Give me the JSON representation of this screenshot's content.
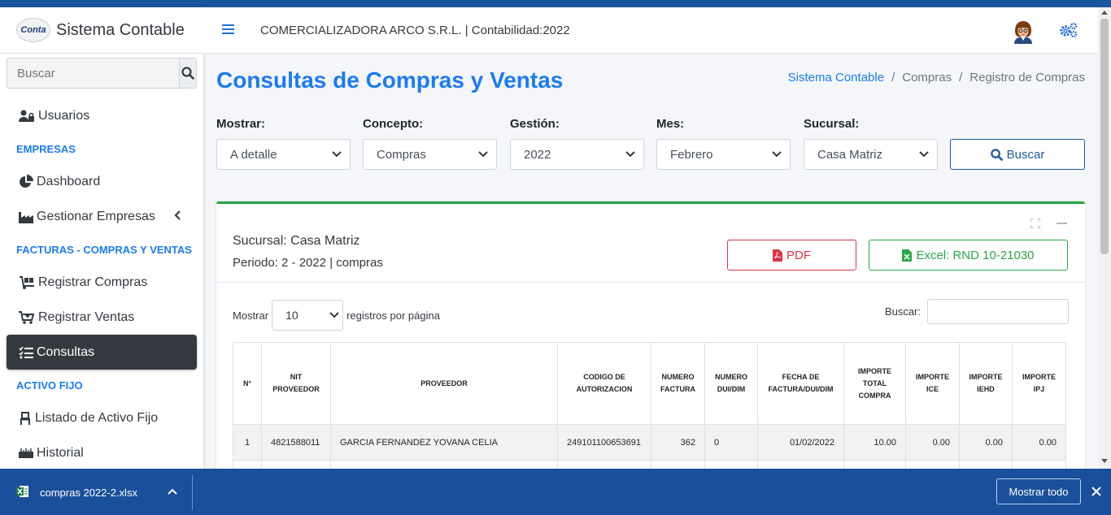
{
  "app": {
    "title": "Sistema Contable",
    "logo_text": "Conta"
  },
  "topbar": {
    "company": "COMERCIALIZADORA ARCO S.R.L. | Contabilidad:2022"
  },
  "sidebar": {
    "search_placeholder": "Buscar",
    "items": [
      {
        "type": "item",
        "label": "Usuarios",
        "icon": "users-lock-icon"
      },
      {
        "type": "header",
        "label": "EMPRESAS"
      },
      {
        "type": "item",
        "label": "Dashboard",
        "icon": "pie-chart-icon"
      },
      {
        "type": "item",
        "label": "Gestionar Empresas",
        "icon": "industry-icon"
      },
      {
        "type": "header",
        "label": "FACTURAS - COMPRAS Y VENTAS"
      },
      {
        "type": "item",
        "label": "Registrar Compras",
        "icon": "dolly-icon"
      },
      {
        "type": "item",
        "label": "Registrar Ventas",
        "icon": "cart-plus-icon"
      },
      {
        "type": "item",
        "label": "Consultas",
        "icon": "list-check-icon",
        "active": true
      },
      {
        "type": "header",
        "label": "ACTIVO FIJO"
      },
      {
        "type": "item",
        "label": "Listado de Activo Fijo",
        "icon": "chair-icon"
      },
      {
        "type": "item",
        "label": "Historial",
        "icon": "ruler-icon"
      }
    ]
  },
  "page": {
    "title": "Consultas de Compras y Ventas",
    "breadcrumb": [
      "Sistema Contable",
      "Compras",
      "Registro de Compras"
    ]
  },
  "filters": {
    "mostrar_label": "Mostrar:",
    "mostrar_value": "A detalle",
    "concepto_label": "Concepto:",
    "concepto_value": "Compras",
    "gestion_label": "Gestión:",
    "gestion_value": "2022",
    "mes_label": "Mes:",
    "mes_value": "Febrero",
    "sucursal_label": "Sucursal:",
    "sucursal_value": "Casa Matriz",
    "buscar_label": "Buscar"
  },
  "report": {
    "sucursal": "Sucursal: Casa Matriz",
    "periodo": "Periodo: 2 - 2022 | compras",
    "pdf_label": "PDF",
    "excel_label": "Excel: RND 10-21030",
    "length_prefix": "Mostrar",
    "length_value": "10",
    "length_suffix": "registros por página",
    "search_label": "Buscar:"
  },
  "table": {
    "headers": [
      "N°",
      "NIT PROVEEDOR",
      "PROVEEDOR",
      "CODIGO DE AUTORIZACION",
      "NUMERO FACTURA",
      "NUMERO DUI/DIM",
      "FECHA DE FACTURA/DUI/DIM",
      "IMPORTE TOTAL COMPRA",
      "IMPORTE ICE",
      "IMPORTE IEHD",
      "IMPORTE IPJ"
    ],
    "rows": [
      [
        "1",
        "4821588011",
        "GARCIA FERNANDEZ YOVANA CELIA",
        "249101100653691",
        "362",
        "0",
        "01/02/2022",
        "10.00",
        "0.00",
        "0.00",
        "0.00"
      ]
    ]
  },
  "downloads": {
    "file": "compras 2022-2.xlsx",
    "show_all": "Mostrar todo"
  }
}
